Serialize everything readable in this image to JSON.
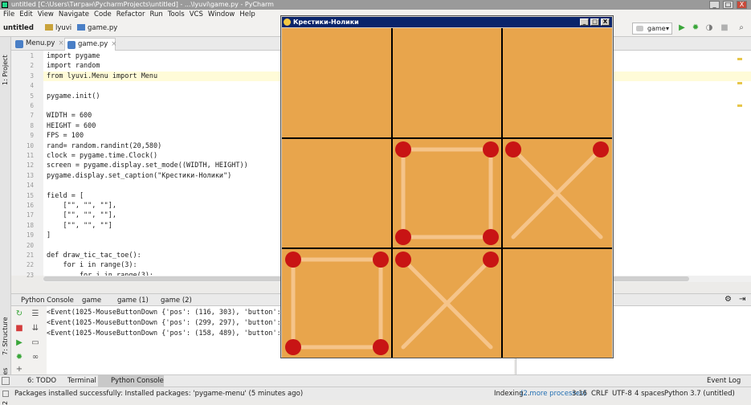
{
  "window": {
    "title": "untitled [C:\\Users\\Тигран\\PycharmProjects\\untitled] - ...\\lyuvi\\game.py - PyCharm",
    "controls": [
      "_",
      "□",
      "X"
    ]
  },
  "menu": [
    "File",
    "Edit",
    "View",
    "Navigate",
    "Code",
    "Refactor",
    "Run",
    "Tools",
    "VCS",
    "Window",
    "Help"
  ],
  "breadcrumbs": [
    "untitled",
    "lyuvi",
    "game.py"
  ],
  "run_config": "game",
  "left_panel_tabs": [
    "1: Project",
    "7: Structure",
    "2: Favorites"
  ],
  "editor_tabs": [
    {
      "label": "Menu.py",
      "active": false
    },
    {
      "label": "game.py",
      "active": true
    }
  ],
  "editor": {
    "current_line": 3,
    "lines": [
      "import pygame",
      "import random",
      "from lyuvi.Menu import Menu",
      "",
      "pygame.init()",
      "",
      "WIDTH = 600",
      "HEIGHT = 600",
      "FPS = 100",
      "rand= random.randint(20,580)",
      "clock = pygame.time.Clock()",
      "screen = pygame.display.set_mode((WIDTH, HEIGHT))",
      "pygame.display.set_caption(\"Крестики-Нолики\")",
      "",
      "field = [",
      "    [\"\", \"\", \"\"],",
      "    [\"\", \"\", \"\"],",
      "    [\"\", \"\", \"\"]",
      "]",
      "",
      "def draw_tic_tac_toe():",
      "    for i in range(3):",
      "        for j in range(3):"
    ]
  },
  "console": {
    "tabs": [
      "Python Console",
      "game",
      "game (1)",
      "game (2)"
    ],
    "output": [
      "<Event(1025-MouseButtonDown {'pos': (116, 303), 'button': 1,",
      "<Event(1025-MouseButtonDown {'pos': (299, 297), 'button': 1,",
      "<Event(1025-MouseButtonDown {'pos': (158, 489), 'button': 1,"
    ]
  },
  "bottom_tabs": [
    "6: TODO",
    "Terminal",
    "Python Console"
  ],
  "event_log": "Event Log",
  "status": {
    "message": "Packages installed successfully: Installed packages: 'pygame-menu' (5 minutes ago)",
    "indexing": "Indexing...",
    "processes": "(2 more processes)",
    "position": "3:16",
    "line_sep": "CRLF",
    "encoding": "UTF-8",
    "indent": "4 spaces",
    "interpreter": "Python 3.7 (untitled)"
  },
  "game": {
    "title": "Крестики-Нолики",
    "controls": [
      "_",
      "□",
      "X"
    ],
    "colors": {
      "board": "#e8a54c",
      "lines": "#000000",
      "matches": "#f5c48a",
      "heads": "#c81414"
    },
    "grid": [
      [
        "",
        "",
        ""
      ],
      [
        "",
        "O",
        "X"
      ],
      [
        "O",
        "X",
        ""
      ]
    ]
  }
}
